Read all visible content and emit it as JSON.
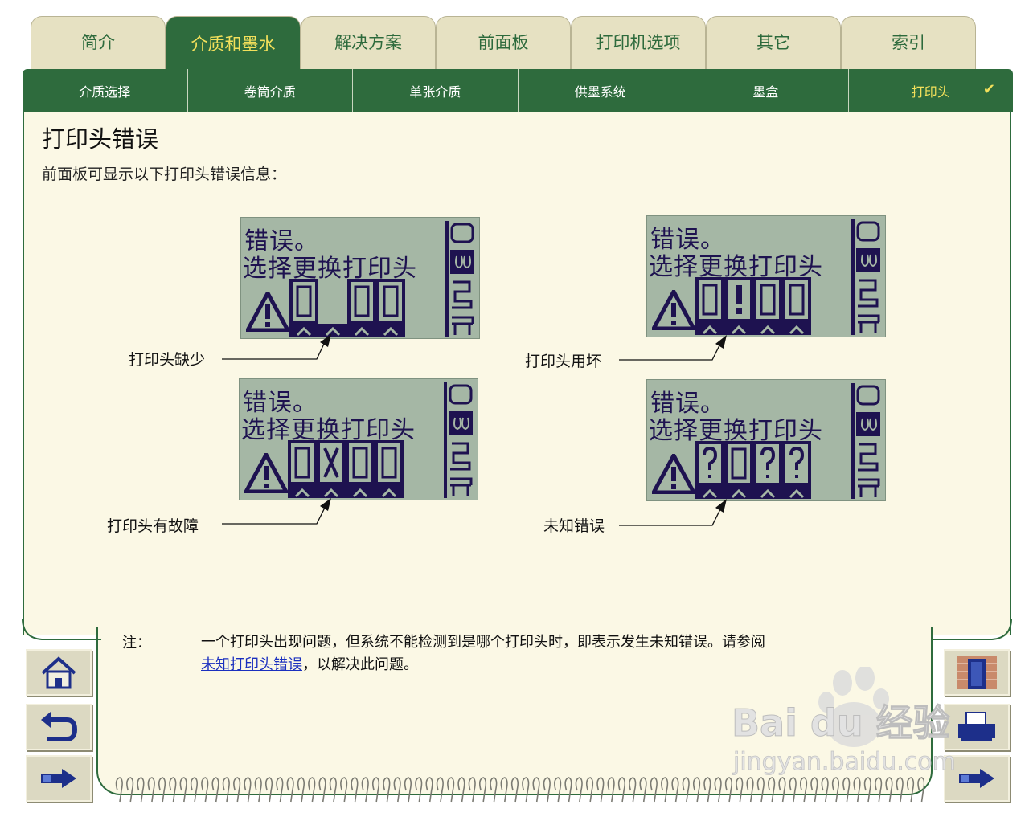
{
  "tabs": [
    "简介",
    "介质和墨水",
    "解决方案",
    "前面板",
    "打印机选项",
    "其它",
    "索引"
  ],
  "subnav": [
    "介质选择",
    "卷筒介质",
    "单张介质",
    "供墨系统",
    "墨盒",
    "打印头"
  ],
  "check_mark": "✔",
  "page_title": "打印头错误",
  "intro": "前面板可显示以下打印头错误信息：",
  "lcd_line1": "错误。",
  "lcd_line2": "选择更换打印头",
  "captions": {
    "missing": "打印头缺少",
    "broken": "打印头用坏",
    "faulty": "打印头有故障",
    "unknown": "未知错误"
  },
  "note": {
    "label": "注：",
    "text_before": "一个打印头出现问题，但系统不能检测到是哪个打印头时，即表示发生未知错误。请参阅",
    "link": "未知打印头错误",
    "text_after": "，以解决此问题。"
  },
  "colors": {
    "brand_green": "#2e6b3d",
    "active_tab_text": "#f3e05b",
    "lcd_bg": "#a5b7a5",
    "lcd_ink": "#1e1250",
    "panel_bg": "#fbf8e5"
  },
  "watermark": {
    "logo": "Bai du 经验",
    "url": "jingyan.baidu.com"
  }
}
